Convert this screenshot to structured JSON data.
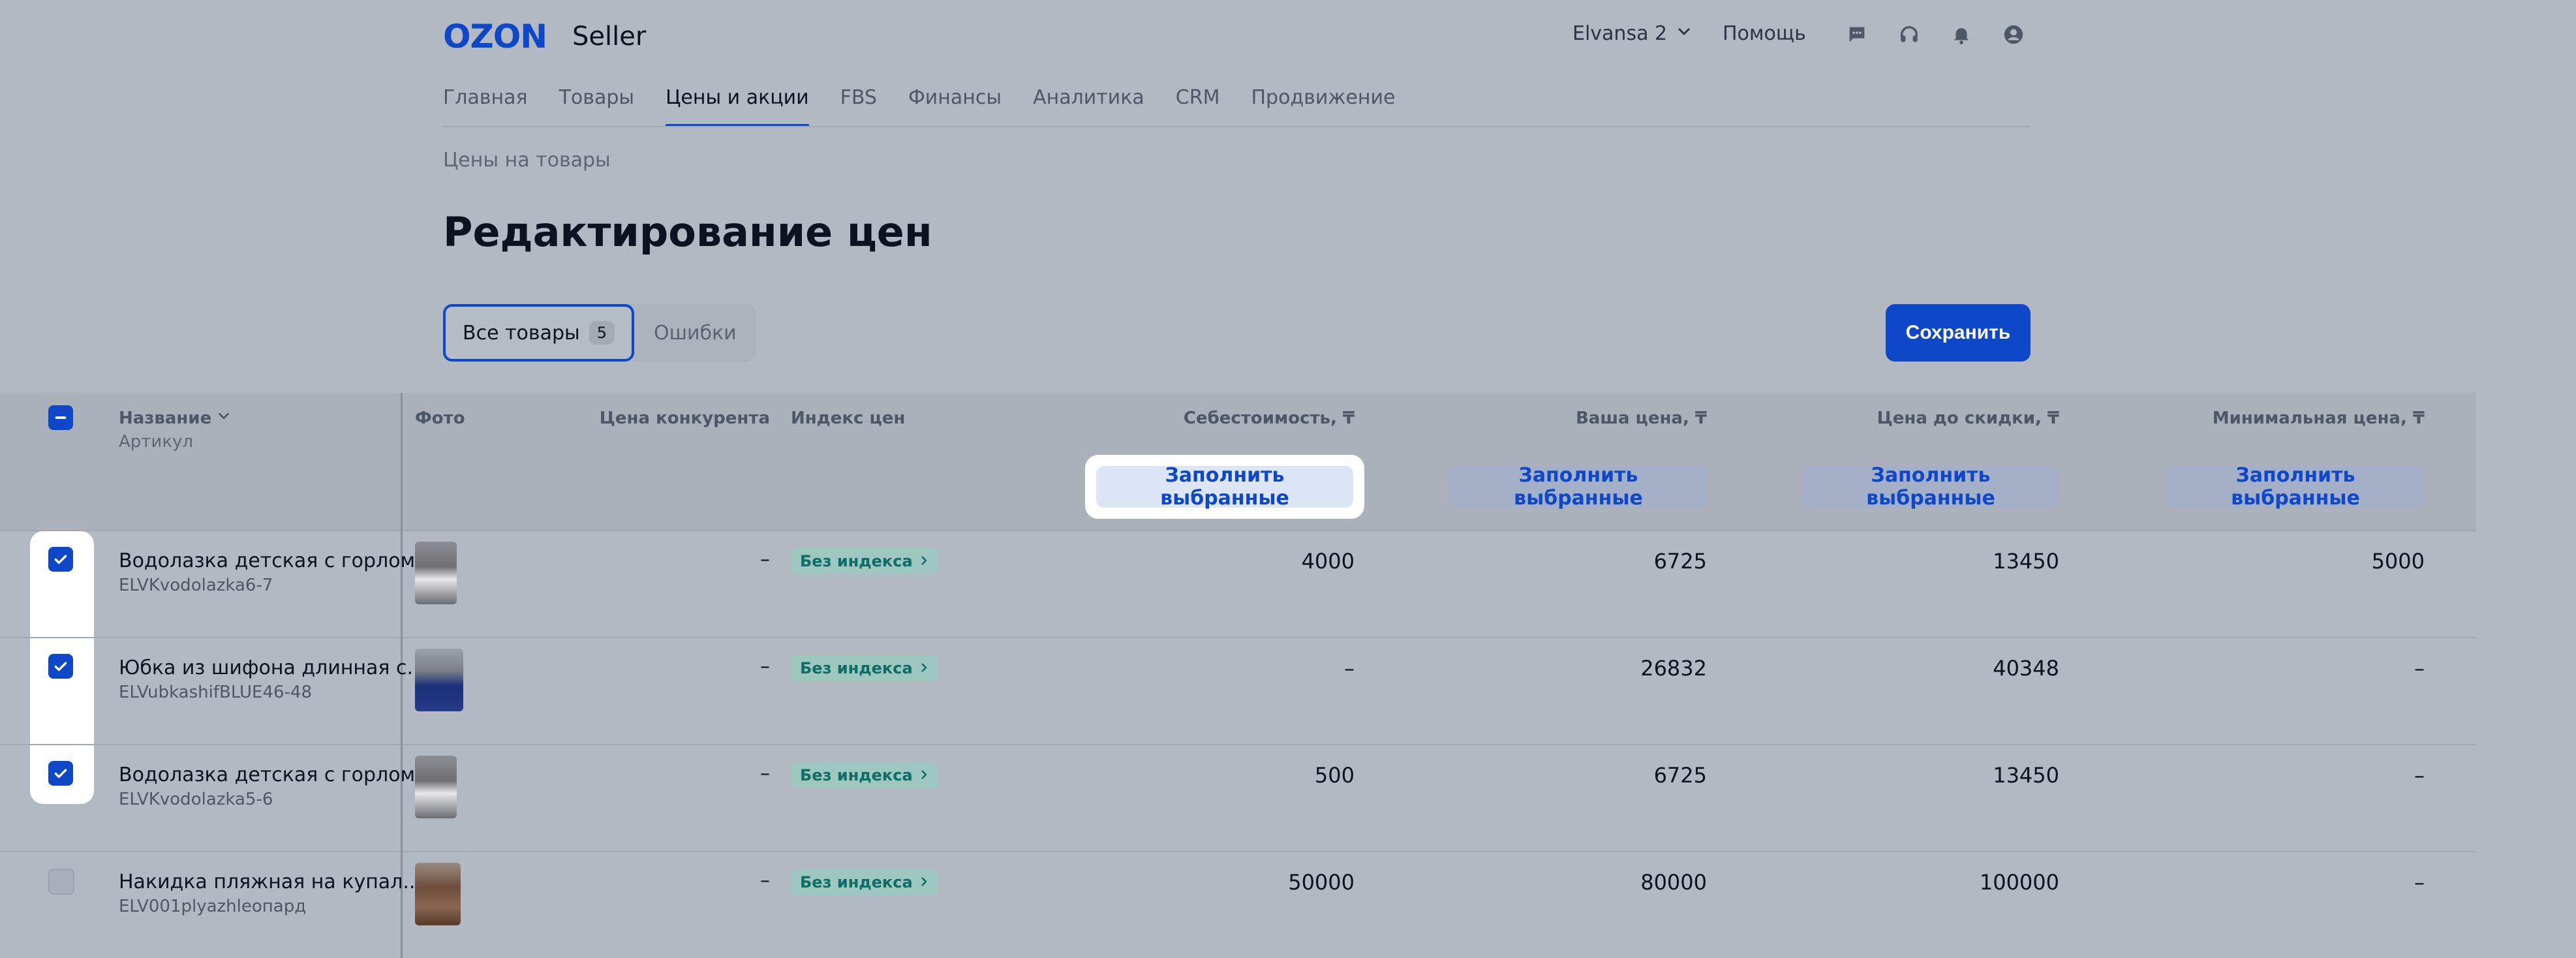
{
  "header": {
    "logo_brand": "OZON",
    "logo_product": "Seller",
    "account": "Elvansa 2",
    "help": "Помощь",
    "icons": [
      "chat-icon",
      "headset-icon",
      "bell-icon",
      "user-icon"
    ]
  },
  "nav": {
    "items": [
      "Главная",
      "Товары",
      "Цены и акции",
      "FBS",
      "Финансы",
      "Аналитика",
      "CRM",
      "Продвижение"
    ],
    "active": "Цены и акции"
  },
  "breadcrumb": "Цены на товары",
  "page_title": "Редактирование цен",
  "filters": {
    "all_label": "Все товары",
    "all_count": "5",
    "errors_label": "Ошибки"
  },
  "save_label": "Сохранить",
  "table": {
    "columns": {
      "name": "Название",
      "sku": "Артикул",
      "photo": "Фото",
      "competitor": "Цена конкурента",
      "index": "Индекс цен",
      "cost": "Себестоимость, ₸",
      "your_price": "Ваша цена, ₸",
      "before_discount": "Цена до скидки, ₸",
      "min_price": "Минимальная цена, ₸"
    },
    "fill_label": "Заполнить выбранные",
    "rows": [
      {
        "name": "Водолазка детская с горлом",
        "sku": "ELVKvodolazka6-7",
        "checked": true,
        "competitor": "–",
        "index": "Без индекса",
        "cost": "4000",
        "your_price": "6725",
        "before_discount": "13450",
        "min_price": "5000"
      },
      {
        "name": "Юбка из шифона длинная с...",
        "sku": "ELVubkashifBLUE46-48",
        "checked": true,
        "competitor": "–",
        "index": "Без индекса",
        "cost": "–",
        "your_price": "26832",
        "before_discount": "40348",
        "min_price": "–"
      },
      {
        "name": "Водолазка детская с горлом",
        "sku": "ELVKvodolazka5-6",
        "checked": true,
        "competitor": "–",
        "index": "Без индекса",
        "cost": "500",
        "your_price": "6725",
        "before_discount": "13450",
        "min_price": "–"
      },
      {
        "name": "Накидка пляжная на купал...",
        "sku": "ELV001plyazhleопард",
        "checked": false,
        "competitor": "–",
        "index": "Без индекса",
        "cost": "50000",
        "your_price": "80000",
        "before_discount": "100000",
        "min_price": "–"
      }
    ]
  },
  "colors": {
    "accent": "#0e47c8",
    "overlay_bg": "#b3b9c2",
    "badge": "#9fc7c1"
  }
}
